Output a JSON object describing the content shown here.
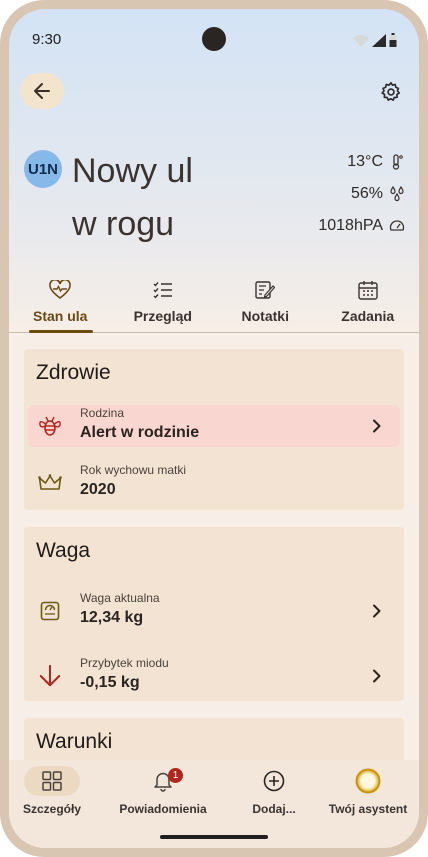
{
  "status_bar": {
    "time": "9:30"
  },
  "header": {
    "avatar_text": "U1N",
    "title_line1": "Nowy ul",
    "title_line2": "w rogu",
    "metrics": [
      {
        "value": "13°C",
        "icon": "thermometer-icon"
      },
      {
        "value": "56%",
        "icon": "humidity-icon"
      },
      {
        "value": "1018hPA",
        "icon": "gauge-icon"
      }
    ]
  },
  "tabs": [
    {
      "label": "Stan ula",
      "icon": "heart-pulse-icon",
      "active": true
    },
    {
      "label": "Przegląd",
      "icon": "checklist-icon",
      "active": false
    },
    {
      "label": "Notatki",
      "icon": "note-edit-icon",
      "active": false
    },
    {
      "label": "Zadania",
      "icon": "calendar-icon",
      "active": false
    }
  ],
  "sections": {
    "health": {
      "title": "Zdrowie",
      "rows": [
        {
          "label": "Rodzina",
          "value": "Alert w rodzinie",
          "icon": "bee-icon",
          "alert": true
        },
        {
          "label": "Rok wychowu matki",
          "value": "2020",
          "icon": "crown-icon"
        }
      ]
    },
    "weight": {
      "title": "Waga",
      "rows": [
        {
          "label": "Waga aktualna",
          "value": "12,34 kg",
          "icon": "scale-icon"
        },
        {
          "label": "Przybytek miodu",
          "value": "-0,15 kg",
          "icon": "arrow-down-icon"
        }
      ]
    },
    "conditions": {
      "title": "Warunki"
    }
  },
  "bottom_nav": [
    {
      "label": "Szczegóły",
      "icon": "grid-icon",
      "active": true
    },
    {
      "label": "Powiadomienia",
      "icon": "bell-icon",
      "badge": "1"
    },
    {
      "label": "Dodaj...",
      "icon": "add-circle-icon"
    },
    {
      "label": "Twój asystent",
      "icon": "assistant-icon"
    }
  ],
  "colors": {
    "accent": "#6b4a12",
    "alert_bg": "#f9d6d0",
    "alert_icon": "#b3261e",
    "avatar_bg": "#86b9ea",
    "card_bg": "#f3e3d3"
  }
}
